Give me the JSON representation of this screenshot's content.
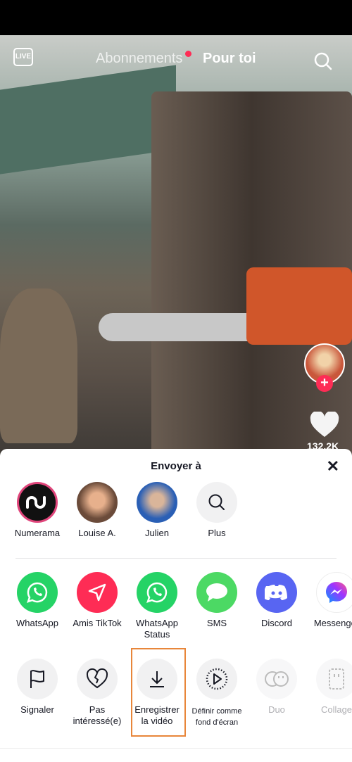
{
  "header": {
    "live_label": "LIVE",
    "tabs": [
      {
        "label": "Abonnements"
      },
      {
        "label": "Pour toi"
      }
    ]
  },
  "video": {
    "likes": "132.2K"
  },
  "sheet": {
    "title": "Envoyer à",
    "contacts": [
      {
        "label": "Numerama"
      },
      {
        "label": "Louise A."
      },
      {
        "label": "Julien"
      },
      {
        "label": "Plus"
      }
    ],
    "apps": [
      {
        "label": "WhatsApp",
        "color": "#25d366"
      },
      {
        "label": "Amis TikTok",
        "color": "#fe2c55"
      },
      {
        "label": "WhatsApp Status",
        "line1": "WhatsApp",
        "line2": "Status",
        "color": "#25d366"
      },
      {
        "label": "SMS",
        "color": "#4cd964"
      },
      {
        "label": "Discord",
        "color": "#5865f2"
      },
      {
        "label": "Messenger",
        "color": "#a033ff"
      }
    ],
    "actions": [
      {
        "line1": "Signaler"
      },
      {
        "line1": "Pas",
        "line2": "intéressé(e)"
      },
      {
        "line1": "Enregistrer",
        "line2": "la vidéo"
      },
      {
        "line1": "Définir comme",
        "line2": "fond d'écran"
      },
      {
        "line1": "Duo"
      },
      {
        "line1": "Collage"
      }
    ],
    "highlight_color": "#e8863a"
  }
}
